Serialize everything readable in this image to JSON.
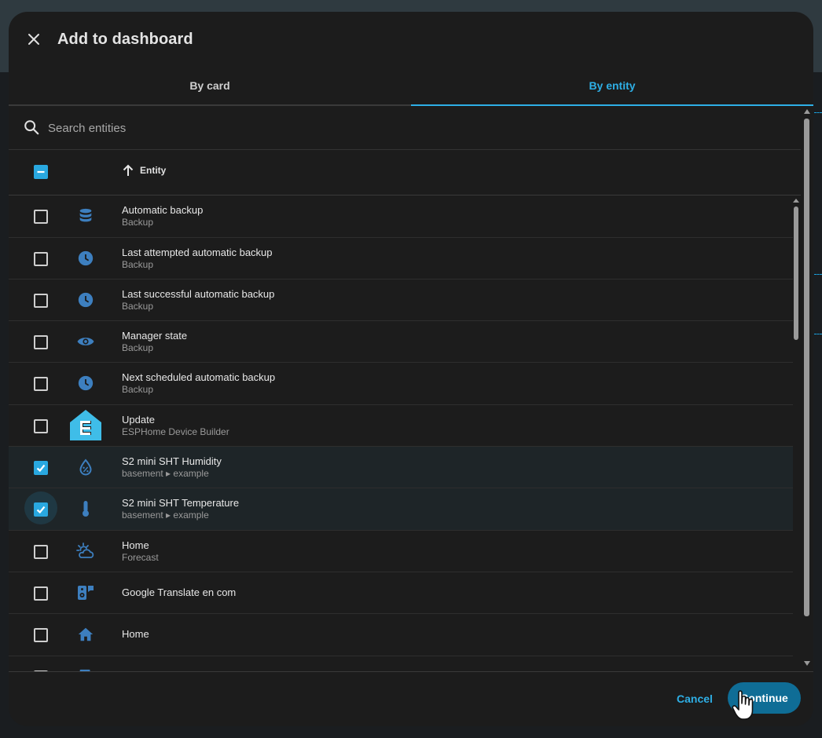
{
  "dialog": {
    "title": "Add to dashboard",
    "tabs": [
      {
        "label": "By card",
        "active": false
      },
      {
        "label": "By entity",
        "active": true
      }
    ]
  },
  "search": {
    "placeholder": "Search entities",
    "value": ""
  },
  "table": {
    "header": {
      "select_all_state": "indeterminate",
      "sort_label": "Entity",
      "sort_direction": "ascending"
    },
    "rows": [
      {
        "name": "Automatic backup",
        "sub": "Backup",
        "icon": "database-icon",
        "checked": false
      },
      {
        "name": "Last attempted automatic backup",
        "sub": "Backup",
        "icon": "clock-icon",
        "checked": false
      },
      {
        "name": "Last successful automatic backup",
        "sub": "Backup",
        "icon": "clock-icon",
        "checked": false
      },
      {
        "name": "Manager state",
        "sub": "Backup",
        "icon": "eye-icon",
        "checked": false
      },
      {
        "name": "Next scheduled automatic backup",
        "sub": "Backup",
        "icon": "clock-icon",
        "checked": false
      },
      {
        "name": "Update",
        "sub": "ESPHome Device Builder",
        "icon": "esphome-logo-icon",
        "checked": false
      },
      {
        "name": "S2 mini SHT Humidity",
        "sub": "basement ▸ example",
        "icon": "water-percent-icon",
        "checked": true
      },
      {
        "name": "S2 mini SHT Temperature",
        "sub": "basement ▸ example",
        "icon": "thermometer-icon",
        "checked": true
      },
      {
        "name": "Home",
        "sub": "Forecast",
        "icon": "weather-partly-cloudy-icon",
        "checked": false
      },
      {
        "name": "Google Translate en com",
        "sub": "",
        "icon": "speaker-message-icon",
        "checked": false
      },
      {
        "name": "Home",
        "sub": "",
        "icon": "home-icon",
        "checked": false
      }
    ]
  },
  "footer": {
    "cancel_label": "Cancel",
    "continue_label": "Continue"
  },
  "colors": {
    "accent": "#2eafe6",
    "icon": "#3d7fbf",
    "primary_button": "#0f6d96",
    "checkbox": "#29a8e0"
  }
}
